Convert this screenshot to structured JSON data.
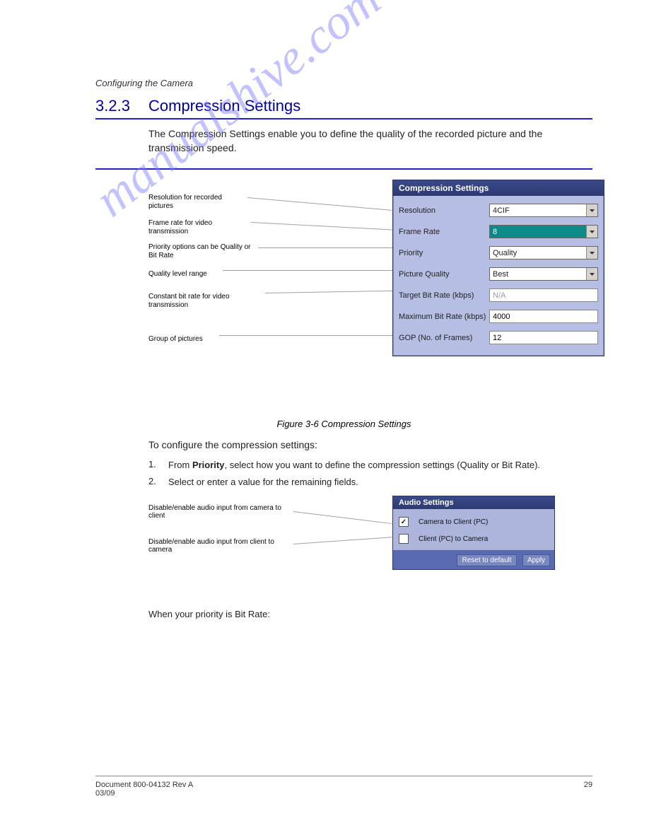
{
  "breadcrumb": "Configuring the Camera",
  "heading_index": "3.2.3",
  "heading_title": "Compression Settings",
  "intro_para": "The Compression Settings enable you to define the quality of the recorded picture and the transmission speed.",
  "panel1": {
    "title": "Compression Settings",
    "resolution_label": "Resolution",
    "resolution_value": "4CIF",
    "framerate_label": "Frame Rate",
    "framerate_value": "8",
    "priority_label": "Priority",
    "priority_value": "Quality",
    "picquality_label": "Picture Quality",
    "picquality_value": "Best",
    "targetbit_label": "Target Bit Rate (kbps)",
    "targetbit_value": "N/A",
    "maxbit_label": "Maximum Bit Rate (kbps)",
    "maxbit_value": "4000",
    "gop_label": "GOP (No. of Frames)",
    "gop_value": "12"
  },
  "callouts1": {
    "c1": "Resolution for recorded pictures",
    "c2": "Frame rate for video transmission",
    "c3": "Priority options can be Quality or Bit Rate",
    "c4": "Quality level range",
    "c5": "Constant bit rate for video transmission",
    "c6": "Group of pictures"
  },
  "figure1_caption": "Figure 3-6 Compression Settings",
  "steps": {
    "s1_num": "1.",
    "s1_txt_prefix": "From ",
    "s1_b": "Priority",
    "s1_txt_suffix": ", select how you want to define the compression settings (Quality or Bit Rate).",
    "s2_num": "2.",
    "s2_txt": "Select or enter a value for the remaining fields."
  },
  "panel2": {
    "title": "Audio Settings",
    "row1_label": "Camera to Client (PC)",
    "row1_checked": true,
    "row2_label": "Client (PC) to Camera",
    "row2_checked": false,
    "btn_reset": "Reset to default",
    "btn_apply": "Apply"
  },
  "callouts2": {
    "c1": "Disable/enable audio input from camera to client",
    "c2": "Disable/enable audio input from client to camera"
  },
  "next_line": "To configure the compression settings:",
  "after_line": "When your priority is Bit Rate:",
  "footer_left": "Document 800-04132 Rev A",
  "footer_right": "29",
  "footer_date": "03/09",
  "watermark": "manualshive.com"
}
